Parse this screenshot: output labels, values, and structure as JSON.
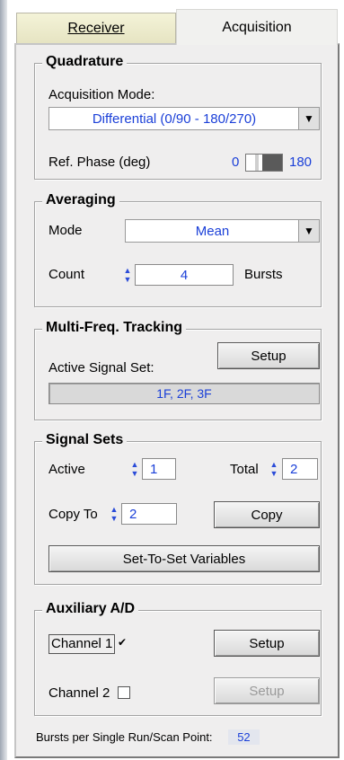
{
  "tabs": {
    "receiver": "Receiver",
    "acquisition": "Acquisition"
  },
  "quadrature": {
    "title": "Quadrature",
    "mode_label": "Acquisition Mode:",
    "mode_value": "Differential (0/90 - 180/270)",
    "ref_phase_label": "Ref. Phase (deg)",
    "ref_phase_min": "0",
    "ref_phase_max": "180"
  },
  "averaging": {
    "title": "Averaging",
    "mode_label": "Mode",
    "mode_value": "Mean",
    "count_label": "Count",
    "count_value": "4",
    "count_unit": "Bursts"
  },
  "multi_freq": {
    "title": "Multi-Freq. Tracking",
    "active_label": "Active Signal Set:",
    "setup_label": "Setup",
    "active_value": "1F, 2F, 3F"
  },
  "signal_sets": {
    "title": "Signal Sets",
    "active_label": "Active",
    "active_value": "1",
    "total_label": "Total",
    "total_value": "2",
    "copy_to_label": "Copy To",
    "copy_to_value": "2",
    "copy_label": "Copy",
    "set_to_set_label": "Set-To-Set Variables"
  },
  "aux_ad": {
    "title": "Auxiliary A/D",
    "channel1_label": "Channel 1",
    "channel1_checked": true,
    "channel1_setup": "Setup",
    "channel2_label": "Channel 2",
    "channel2_checked": false,
    "channel2_setup": "Setup"
  },
  "status": {
    "label": "Bursts per Single Run/Scan Point:",
    "value": "52"
  },
  "colors": {
    "value_text": "#1a3fd8",
    "panel_bg": "#efeeee"
  }
}
